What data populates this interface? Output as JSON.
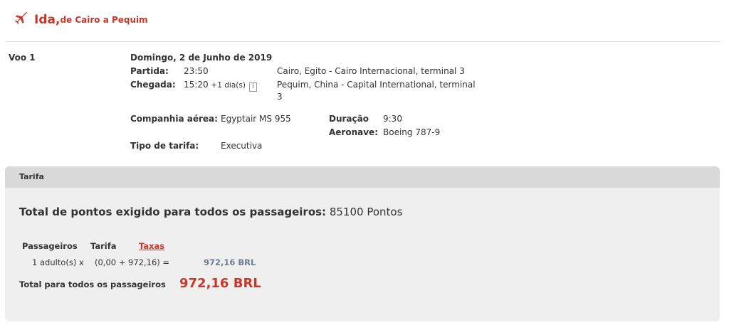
{
  "header": {
    "title": "Ida,",
    "subtitle": "de Cairo a Pequim",
    "icon": "airplane-icon",
    "accent": "#c8382a"
  },
  "flight": {
    "label": "Voo 1",
    "date": "Domingo, 2 de Junho de 2019",
    "departure_label": "Partida:",
    "departure_time": "23:50",
    "departure_place": "Cairo, Egito - Cairo Internacional, terminal 3",
    "arrival_label": "Chegada:",
    "arrival_time": "15:20",
    "arrival_plus": "+1 dia(s)",
    "info_glyph": "i",
    "arrival_place": "Pequim, China - Capital International, terminal 3",
    "airline_label": "Companhia aérea:",
    "airline": "Egyptair MS 955",
    "duration_label": "Duração",
    "duration": "9:30",
    "aircraft_label": "Aeronave:",
    "aircraft": "Boeing 787-9",
    "fare_type_label": "Tipo de tarifa:",
    "fare_type": "Executiva"
  },
  "fare": {
    "title": "Tarifa",
    "total_points_label": "Total de pontos exigido para todos os passageiros:",
    "total_points_value": "85100 Pontos",
    "columns": [
      "Passageiros",
      "Tarifa",
      "Taxas"
    ],
    "calc": {
      "pax": "1 adulto(s) x",
      "formula": "(0,00 + 972,16) =",
      "total": "972,16 BRL"
    },
    "all_label": "Total para todos os passageiros",
    "all_value": "972,16 BRL"
  }
}
